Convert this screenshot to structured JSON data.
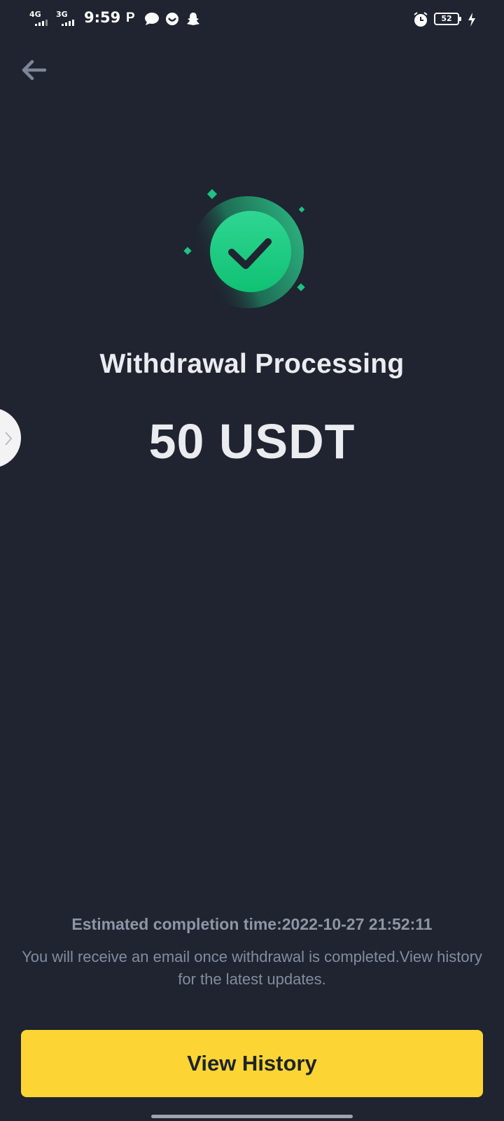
{
  "status_bar": {
    "network_1": "4G",
    "network_2": "3G",
    "time": "9:59",
    "notification_icons": [
      "parking-icon",
      "message-icon",
      "reaction-icon",
      "snapchat-icon"
    ],
    "alarm_icon": "alarm-icon",
    "battery_level": "52",
    "charging_icon": "bolt-icon"
  },
  "header": {
    "back_icon": "arrow-left-icon"
  },
  "result": {
    "icon": "check-circle-icon",
    "title": "Withdrawal Processing",
    "amount": "50 USDT"
  },
  "footer": {
    "estimate": "Estimated completion time:2022-10-27 21:52:11",
    "note": "You will receive an email once withdrawal is completed.View history for the latest updates.",
    "button_label": "View History"
  },
  "colors": {
    "background": "#1f2430",
    "accent_green": "#0ecb81",
    "button_yellow": "#fcd535",
    "primary_text": "#eaecef",
    "secondary_text": "#848d9b"
  }
}
